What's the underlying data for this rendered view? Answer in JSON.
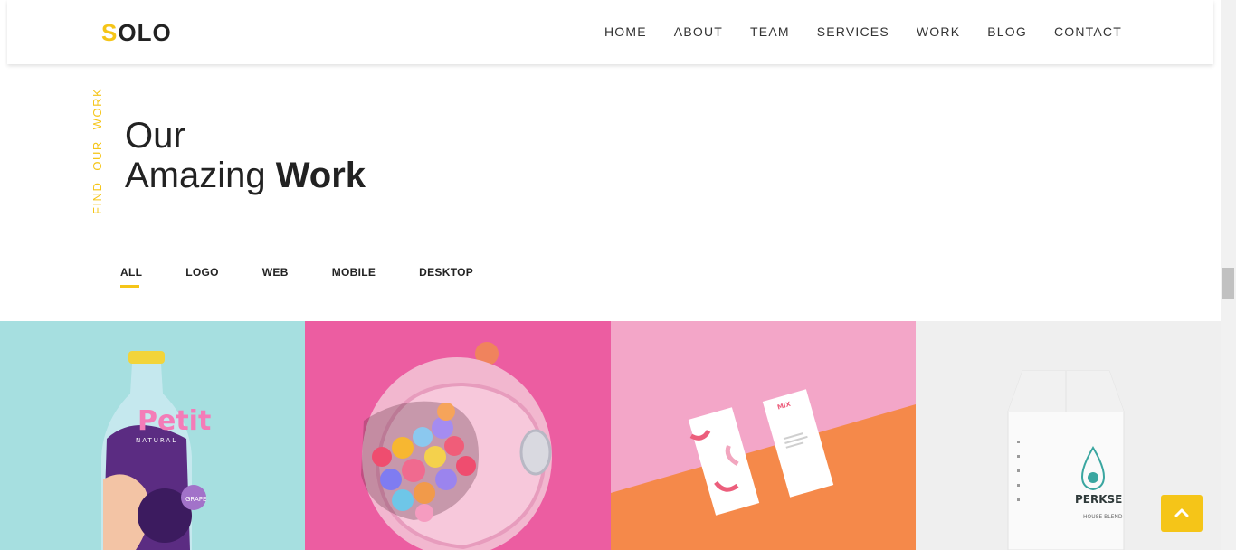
{
  "brand": {
    "logo_first": "S",
    "logo_rest": "OLO",
    "accent_color": "#f5c518"
  },
  "nav": {
    "items": [
      {
        "label": "HOME"
      },
      {
        "label": "ABOUT"
      },
      {
        "label": "TEAM"
      },
      {
        "label": "SERVICES"
      },
      {
        "label": "WORK"
      },
      {
        "label": "BLOG"
      },
      {
        "label": "CONTACT"
      }
    ]
  },
  "section": {
    "vertical_label": [
      "FIND",
      "OUR",
      "WORK"
    ],
    "title_line1": "Our",
    "title_line2_light": "Amazing",
    "title_line2_bold": "Work"
  },
  "filters": {
    "items": [
      {
        "label": "ALL",
        "active": true
      },
      {
        "label": "LOGO",
        "active": false
      },
      {
        "label": "WEB",
        "active": false
      },
      {
        "label": "MOBILE",
        "active": false
      },
      {
        "label": "DESKTOP",
        "active": false
      }
    ]
  },
  "gallery": {
    "tiles": [
      {
        "label_top": "Petit",
        "label_mid": "NATURAL",
        "badge": "GRAPE",
        "bg": "#a6dfe0"
      },
      {
        "bg": "#ec5da1"
      },
      {
        "card_text": "MIX",
        "bg": "#f3a6c8"
      },
      {
        "brand": "PERKSE",
        "sub": "HOUSE BLEND",
        "bg": "#efefef"
      }
    ]
  },
  "icons": {
    "back_to_top": "chevron-up-icon"
  }
}
